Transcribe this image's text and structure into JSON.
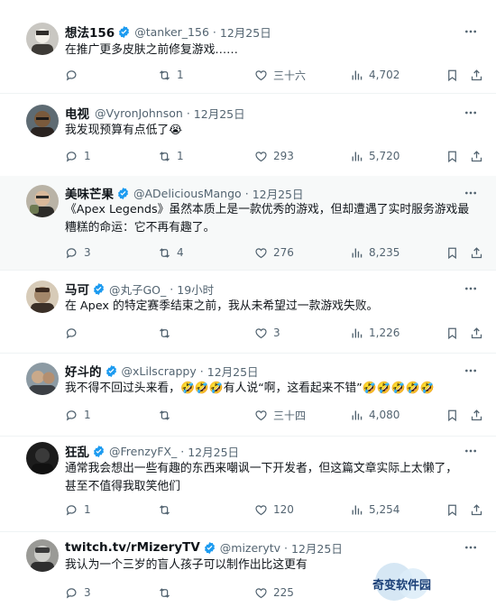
{
  "tweets": [
    {
      "name": "想法156",
      "verified": true,
      "handle": "@tanker_156",
      "sep": "·",
      "time": "12月25日",
      "lines": [
        "在推广更多皮肤之前修复游戏……"
      ],
      "reply": "",
      "retweet": "1",
      "like": "三十六",
      "views": "4,702",
      "avatar_colors": [
        "#c9c7c2",
        "#3d3a36"
      ]
    },
    {
      "name": "电视",
      "verified": false,
      "handle": "@VyronJohnson",
      "sep": "·",
      "time": "12月25日",
      "lines": [
        "我发现预算有点低了😭"
      ],
      "reply": "1",
      "retweet": "1",
      "like": "293",
      "views": "5,720",
      "avatar_colors": [
        "#7a5a3c",
        "#2a2320"
      ]
    },
    {
      "name": "美味芒果",
      "verified": true,
      "handle": "@ADeliciousMango",
      "sep": "·",
      "time": "12月25日",
      "lines": [
        "《Apex Legends》虽然本质上是一款优秀的游戏，但却遭遇了实时服务游戏最",
        "糟糕的命运：它不再有趣了。"
      ],
      "reply": "3",
      "retweet": "4",
      "like": "276",
      "views": "8,235",
      "avatar_colors": [
        "#6d7a52",
        "#2c2b28"
      ]
    },
    {
      "name": "马可",
      "verified": true,
      "handle": "@丸子GO_",
      "sep": "·",
      "time": "19小时",
      "lines": [
        "在 Apex 的特定赛季结束之前，我从未希望过一款游戏失败。"
      ],
      "reply": "",
      "retweet": "",
      "like": "3",
      "views": "1,226",
      "avatar_colors": [
        "#a3876a",
        "#3a2f27"
      ]
    },
    {
      "name": "好斗的",
      "verified": true,
      "handle": "@xLilscrappy",
      "sep": "·",
      "time": "12月25日",
      "lines": [
        "我不得不回过头来看，🤣🤣🤣有人说“啊，这看起来不错”🤣🤣🤣🤣🤣"
      ],
      "reply": "1",
      "retweet": "",
      "like": "三十四",
      "views": "4,080",
      "avatar_colors": [
        "#8c9aa3",
        "#3b3f44"
      ]
    },
    {
      "name": "狂乱",
      "verified": true,
      "handle": "@FrenzyFX_",
      "sep": "·",
      "time": "12月25日",
      "lines": [
        "通常我会想出一些有趣的东西来嘲讽一下开发者，但这篇文章实际上太懒了，",
        "甚至不值得我取笑他们"
      ],
      "reply": "1",
      "retweet": "",
      "like": "120",
      "views": "5,254",
      "avatar_colors": [
        "#2b2b2b",
        "#111111"
      ]
    },
    {
      "name": "twitch.tv/rMizeryTV",
      "verified": true,
      "handle": "@mizerytv",
      "sep": "·",
      "time": "12月25日",
      "lines": [
        "我认为一个三岁的盲人孩子可以制作出比这更有"
      ],
      "reply": "3",
      "retweet": "",
      "like": "225",
      "views": "",
      "avatar_colors": [
        "#9a9a96",
        "#2e2e2e"
      ]
    }
  ],
  "watermark": {
    "text": "奇变软件园"
  },
  "colors": {
    "verified": "#1d9bf0",
    "muted": "#536471",
    "text": "#0f1419",
    "divider": "#eff3f4"
  }
}
